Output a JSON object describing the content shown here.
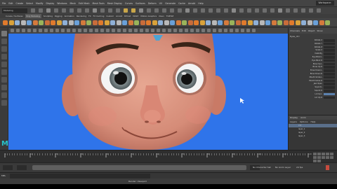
{
  "menubar": {
    "items": [
      "File",
      "Edit",
      "Create",
      "Select",
      "Modify",
      "Display",
      "Windows",
      "Mesh",
      "Edit Mesh",
      "Mesh Tools",
      "Mesh Display",
      "Curves",
      "Surfaces",
      "Deform",
      "UV",
      "Generate",
      "Cache",
      "Arnold",
      "Help"
    ],
    "workspace": "Workspace:"
  },
  "status": {
    "mode": "Modeling"
  },
  "shelf": {
    "tabs": [
      "Curves / Surfaces",
      "Poly Modeling",
      "Sculpting",
      "Rigging",
      "Animation",
      "Rendering",
      "FX",
      "FX Caching",
      "Custom",
      "Arnold",
      "Bifrost",
      "MASH",
      "Motion Graphics",
      "XGen",
      "TURTLE"
    ],
    "active_tab": "Poly Modeling"
  },
  "viewport": {
    "camera_label": "persp",
    "background": "#2f74ea"
  },
  "channel_box": {
    "tabs": [
      "Channels",
      "Edit",
      "Object",
      "Show"
    ],
    "object": "Eyes_ctrl",
    "attributes": [
      "Rotate X",
      "Rotate Y",
      "Rotate Z",
      "Scale X",
      "Visibility",
      "Eye Blink L",
      "Eye Blink R",
      "Brow Up L",
      "Brow Up R",
      "Brow Down L",
      "Brow Down R",
      "Mouth Smile L",
      "Mouth Smile R",
      "Jaw Open",
      "Squint L",
      "Squint R",
      "Lid Up L",
      "Lid Up R"
    ],
    "selected_index": 16
  },
  "layers": {
    "tabs": [
      "Display",
      "Anim"
    ],
    "menu": [
      "Layers",
      "Options",
      "Help"
    ],
    "items": [
      "V P",
      "layer_1",
      "layer_2",
      "layer_3"
    ]
  },
  "timeline": {
    "frames": [
      "1",
      "10",
      "20",
      "30",
      "40",
      "50",
      "60",
      "70",
      "80",
      "90",
      "100",
      "110",
      "120"
    ],
    "start": "1",
    "end": "120",
    "current": "1",
    "no_char_set": "No Character Set",
    "no_anim_layer": "No Anim Layer",
    "fps": "24 fps"
  },
  "command": {
    "mel": "MEL"
  },
  "help": {
    "text": "Render: Viewport"
  },
  "logo": "M"
}
